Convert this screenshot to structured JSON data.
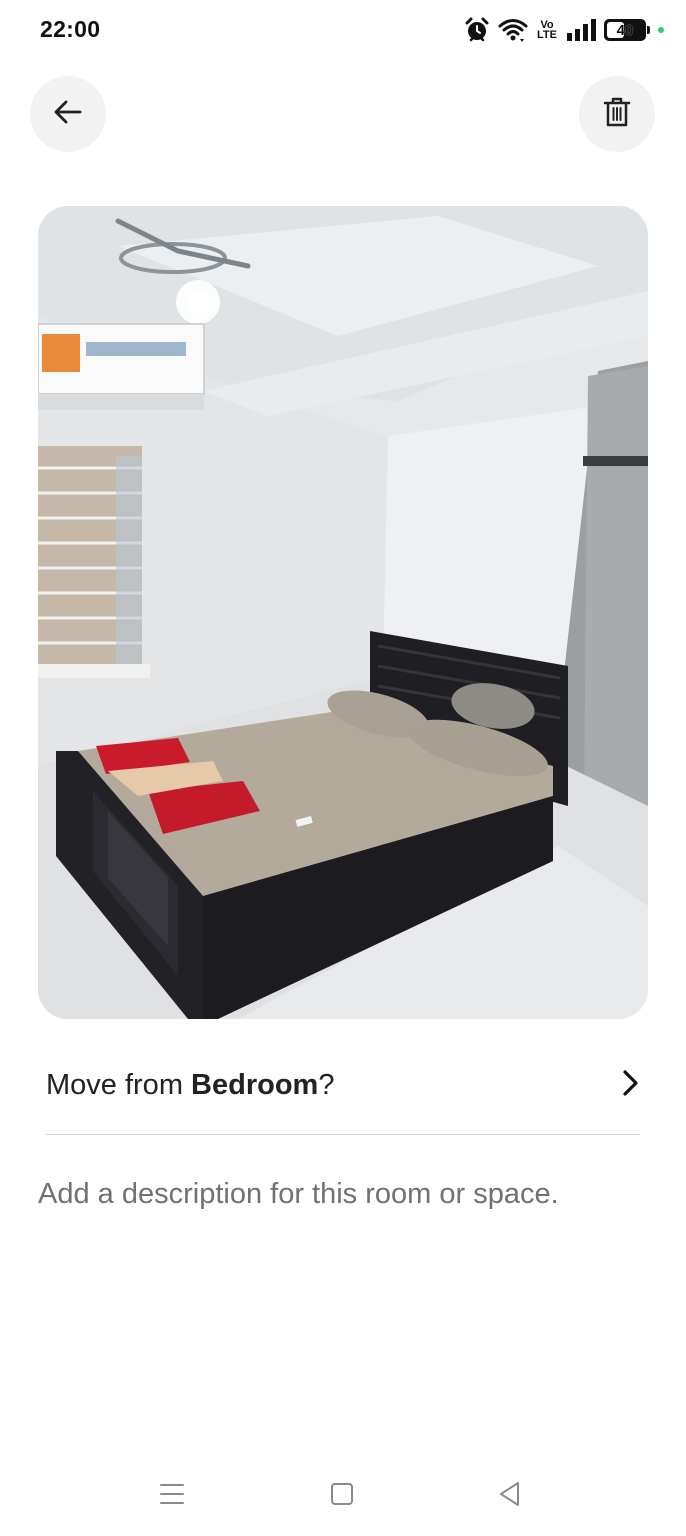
{
  "status_bar": {
    "time": "22:00",
    "battery_level": "40",
    "icons": [
      "alarm-icon",
      "wifi-icon",
      "volte-icon",
      "signal-icon",
      "battery-icon"
    ],
    "volte_line1": "Vo",
    "volte_line2": "LTE"
  },
  "header": {
    "back_icon": "arrow-left-icon",
    "delete_icon": "trash-icon"
  },
  "photo": {
    "subject": "bedroom-photo"
  },
  "move": {
    "prefix": "Move from ",
    "room": "Bedroom",
    "suffix": "?",
    "chevron_icon": "chevron-right-icon"
  },
  "description": {
    "placeholder": "Add a description for this room or space.",
    "value": ""
  },
  "nav_bar": {
    "icons": [
      "menu-icon",
      "home-square-icon",
      "back-triangle-icon"
    ]
  },
  "colors": {
    "text_primary": "#222222",
    "text_secondary": "#717171",
    "button_bg": "#f2f2f2",
    "divider": "#cfcfcf"
  }
}
